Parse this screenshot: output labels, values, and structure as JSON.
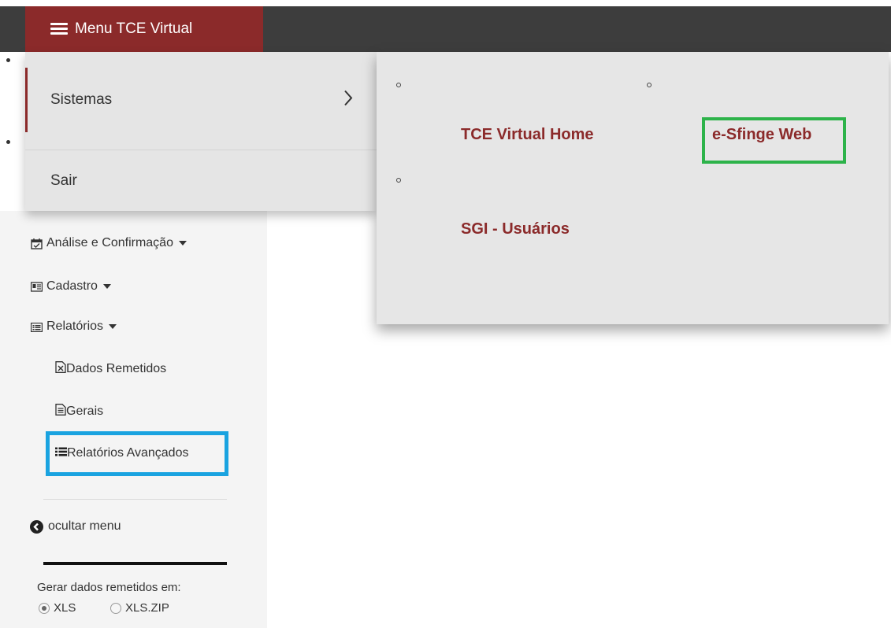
{
  "topbar": {
    "menu_label": "Menu TCE Virtual"
  },
  "dropdown": {
    "items": [
      {
        "label": "Sistemas",
        "chevron": ">"
      },
      {
        "label": "Sair"
      }
    ]
  },
  "submenu": {
    "links": [
      {
        "label": "TCE Virtual Home"
      },
      {
        "label": "e-Sfinge Web"
      },
      {
        "label": "SGI - Usuários"
      }
    ]
  },
  "sidebar": {
    "items": [
      {
        "label": "Análise e Confirmação",
        "icon": "calendar-check-icon"
      },
      {
        "label": "Cadastro",
        "icon": "id-card-icon"
      },
      {
        "label": "Relatórios",
        "icon": "list-alt-icon"
      }
    ],
    "subitems": [
      {
        "label": "Dados Remetidos",
        "icon": "file-excel-icon"
      },
      {
        "label": "Gerais",
        "icon": "file-text-icon"
      },
      {
        "label": "Relatórios Avançados",
        "icon": "list-icon"
      }
    ],
    "hide_menu": "ocultar menu",
    "generate_label": "Gerar dados remetidos em:",
    "format_options": [
      "XLS",
      "XLS.ZIP"
    ],
    "selected_format": "XLS"
  },
  "highlights": {
    "green": "#2db34a",
    "blue": "#1aa3e0",
    "brand": "#8b2a2a"
  }
}
